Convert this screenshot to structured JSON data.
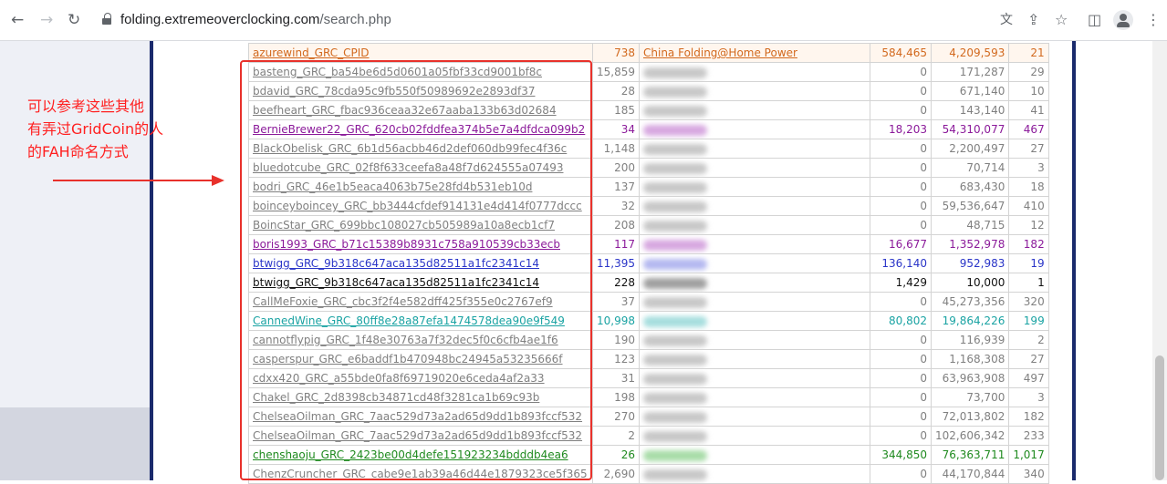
{
  "browser": {
    "url_host": "folding.extremeoverclocking.com",
    "url_path": "/search.php",
    "back_icon": "back-arrow-icon",
    "forward_icon": "forward-arrow-icon",
    "reload_icon": "reload-icon",
    "lock_icon": "lock-icon",
    "right_icons": [
      "translate-icon",
      "share-icon",
      "star-icon",
      "side-panel-icon",
      "profile-icon",
      "menu-icon"
    ]
  },
  "annotation": {
    "lines": [
      "可以参考这些其他",
      "有弄过GridCoin的人",
      "的FAH命名方式"
    ],
    "color": "#ff2020"
  },
  "rows": [
    {
      "name": "azurewind_GRC_CPID",
      "n1": "738",
      "team": "China Folding@Home Power",
      "n2": "584,465",
      "n3": "4,209,593",
      "n4": "21",
      "color": "#d2691e",
      "team_blur": false,
      "bg": "#fff6ee"
    },
    {
      "name": "basteng_GRC_ba54be6d5d0601a05fbf33cd9001bf8c",
      "n1": "15,859",
      "team": "",
      "n2": "0",
      "n3": "171,287",
      "n4": "29",
      "color": "#808080",
      "team_blur": true,
      "blur_w": 40
    },
    {
      "name": "bdavid_GRC_78cda95c9fb550f50989692e2893df37",
      "n1": "28",
      "team": "",
      "n2": "0",
      "n3": "671,140",
      "n4": "10",
      "color": "#808080",
      "team_blur": true,
      "blur_w": 90
    },
    {
      "name": "beefheart_GRC_fbac936ceaa32e67aaba133b63d02684",
      "n1": "185",
      "team": "",
      "n2": "0",
      "n3": "143,140",
      "n4": "41",
      "color": "#808080",
      "team_blur": true,
      "blur_w": 70
    },
    {
      "name": "BernieBrewer22_GRC_620cb02fddfea374b5e7a4dfdca099b2",
      "n1": "34",
      "team": "",
      "n2": "18,203",
      "n3": "54,310,077",
      "n4": "467",
      "color": "#8b1a9a",
      "team_blur": true,
      "blur_w": 46,
      "blur_color": "#d7a8e0"
    },
    {
      "name": "BlackObelisk_GRC_6b1d56acbb46d2def060db99fec4f36c",
      "n1": "1,148",
      "team": "",
      "n2": "0",
      "n3": "2,200,497",
      "n4": "27",
      "color": "#808080",
      "team_blur": true,
      "blur_w": 60
    },
    {
      "name": "bluedotcube_GRC_02f8f633ceefa8a48f7d624555a07493",
      "n1": "200",
      "team": "",
      "n2": "0",
      "n3": "70,714",
      "n4": "3",
      "color": "#808080",
      "team_blur": true,
      "blur_w": 40
    },
    {
      "name": "bodri_GRC_46e1b5eaca4063b75e28fd4b531eb10d",
      "n1": "137",
      "team": "",
      "n2": "0",
      "n3": "683,430",
      "n4": "18",
      "color": "#808080",
      "team_blur": true,
      "blur_w": 40
    },
    {
      "name": "boinceyboincey_GRC_bb3444cfdef914131e4d414f0777dccc",
      "n1": "32",
      "team": "",
      "n2": "0",
      "n3": "59,536,647",
      "n4": "410",
      "color": "#808080",
      "team_blur": true,
      "blur_w": 40
    },
    {
      "name": "BoincStar_GRC_699bbc108027cb505989a10a8ecb1cf7",
      "n1": "208",
      "team": "",
      "n2": "0",
      "n3": "48,715",
      "n4": "12",
      "color": "#808080",
      "team_blur": true,
      "blur_w": 40
    },
    {
      "name": "boris1993_GRC_b71c15389b8931c758a910539cb33ecb",
      "n1": "117",
      "team": "",
      "n2": "16,677",
      "n3": "1,352,978",
      "n4": "182",
      "color": "#8b1a9a",
      "team_blur": true,
      "blur_w": 46,
      "blur_color": "#d7a8e0"
    },
    {
      "name": "btwigg_GRC_9b318c647aca135d82511a1fc2341c14",
      "n1": "11,395",
      "team": "",
      "n2": "136,140",
      "n3": "952,983",
      "n4": "19",
      "color": "#2a35c8",
      "team_blur": true,
      "blur_w": 46,
      "blur_color": "#b4b8f0"
    },
    {
      "name": "btwigg_GRC_9b318c647aca135d82511a1fc2341c14",
      "n1": "228",
      "team": "",
      "n2": "1,429",
      "n3": "10,000",
      "n4": "1",
      "color": "#111111",
      "team_blur": true,
      "blur_w": 46,
      "blur_color": "#a0a0a0"
    },
    {
      "name": "CallMeFoxie_GRC_cbc3f2f4e582dff425f355e0c2767ef9",
      "n1": "37",
      "team": "",
      "n2": "0",
      "n3": "45,273,356",
      "n4": "320",
      "color": "#808080",
      "team_blur": true,
      "blur_w": 40
    },
    {
      "name": "CannedWine_GRC_80ff8e28a87efa1474578dea90e9f549",
      "n1": "10,998",
      "team": "",
      "n2": "80,802",
      "n3": "19,864,226",
      "n4": "199",
      "color": "#1aa3a3",
      "team_blur": true,
      "blur_w": 110,
      "blur_color": "#a6dede"
    },
    {
      "name": "cannotflypig_GRC_1f48e30763a7f32dec5f0c6cfb4ae1f6",
      "n1": "190",
      "team": "",
      "n2": "0",
      "n3": "116,939",
      "n4": "2",
      "color": "#808080",
      "team_blur": true,
      "blur_w": 40
    },
    {
      "name": "casperspur_GRC_e6baddf1b470948bc24945a53235666f",
      "n1": "123",
      "team": "",
      "n2": "0",
      "n3": "1,168,308",
      "n4": "27",
      "color": "#808080",
      "team_blur": true,
      "blur_w": 40
    },
    {
      "name": "cdxx420_GRC_a55bde0fa8f69719020e6ceda4af2a33",
      "n1": "31",
      "team": "",
      "n2": "0",
      "n3": "63,963,908",
      "n4": "497",
      "color": "#808080",
      "team_blur": true,
      "blur_w": 40
    },
    {
      "name": "Chakel_GRC_2d8398cb34871cd48f3281ca1b69c93b",
      "n1": "198",
      "team": "",
      "n2": "0",
      "n3": "73,700",
      "n4": "3",
      "color": "#808080",
      "team_blur": true,
      "blur_w": 40
    },
    {
      "name": "ChelseaOilman_GRC_7aac529d73a2ad65d9dd1b893fccf532",
      "n1": "270",
      "team": "",
      "n2": "0",
      "n3": "72,013,802",
      "n4": "182",
      "color": "#808080",
      "team_blur": true,
      "blur_w": 56
    },
    {
      "name": "ChelseaOilman_GRC_7aac529d73a2ad65d9dd1b893fccf532",
      "n1": "2",
      "team": "",
      "n2": "0",
      "n3": "102,606,342",
      "n4": "233",
      "color": "#808080",
      "team_blur": true,
      "blur_w": 90
    },
    {
      "name": "chenshaoju_GRC_2423be00d4defe151923234bdddb4ea6",
      "n1": "26",
      "team": "",
      "n2": "344,850",
      "n3": "76,363,711",
      "n4": "1,017",
      "color": "#1f8a1f",
      "team_blur": true,
      "blur_w": 46,
      "blur_color": "#a8dca8"
    },
    {
      "name": "ChenzCruncher_GRC_cabe9e1ab39a46d44e1879323ce5f365",
      "n1": "2,690",
      "team": "",
      "n2": "0",
      "n3": "44,170,844",
      "n4": "340",
      "color": "#808080",
      "team_blur": true,
      "blur_w": 40
    }
  ]
}
